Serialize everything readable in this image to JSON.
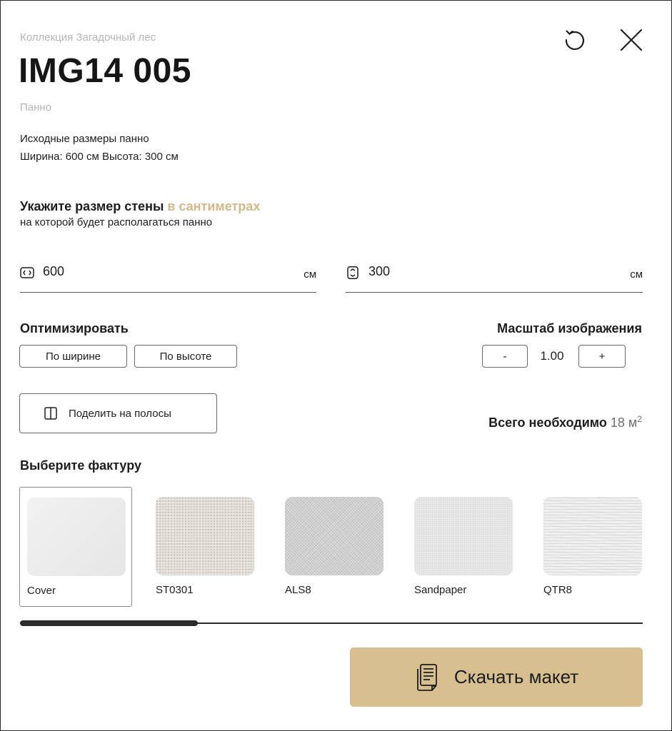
{
  "header": {
    "collection": "Коллекция Загадочный лес",
    "title": "IMG14 005",
    "subtitle": "Панно",
    "reset_icon": "reset-icon",
    "close_icon": "close-icon"
  },
  "original_size": {
    "heading": "Исходные размеры панно",
    "dims": "Ширина: 600 см Высота: 300 см"
  },
  "wall": {
    "title": "Укажите размер стены",
    "title_accent": "в сантиметрах",
    "subtitle": "на которой будет располагаться панно",
    "width": {
      "value": "600",
      "unit": "см",
      "icon": "width-icon"
    },
    "height": {
      "value": "300",
      "unit": "см",
      "icon": "height-icon"
    }
  },
  "optimize": {
    "label": "Оптимизировать",
    "by_width": "По ширине",
    "by_height": "По высоте"
  },
  "scale": {
    "label": "Масштаб изображения",
    "minus": "-",
    "value": "1.00",
    "plus": "+"
  },
  "split": {
    "label": "Поделить на полосы",
    "icon": "split-columns-icon"
  },
  "total": {
    "label": "Всего необходимо",
    "value": "18 м",
    "unit_power": "2"
  },
  "textures": {
    "label": "Выберите фактуру",
    "selected_index": 0,
    "items": [
      {
        "name": "Cover"
      },
      {
        "name": "ST0301"
      },
      {
        "name": "ALS8"
      },
      {
        "name": "Sandpaper"
      },
      {
        "name": "QTR8"
      }
    ],
    "scroll_fraction": 0.285
  },
  "download": {
    "label": "Скачать макет",
    "icon": "document-icon"
  },
  "colors": {
    "accent": "#d5b888",
    "download_bg": "#d7bf8f"
  }
}
